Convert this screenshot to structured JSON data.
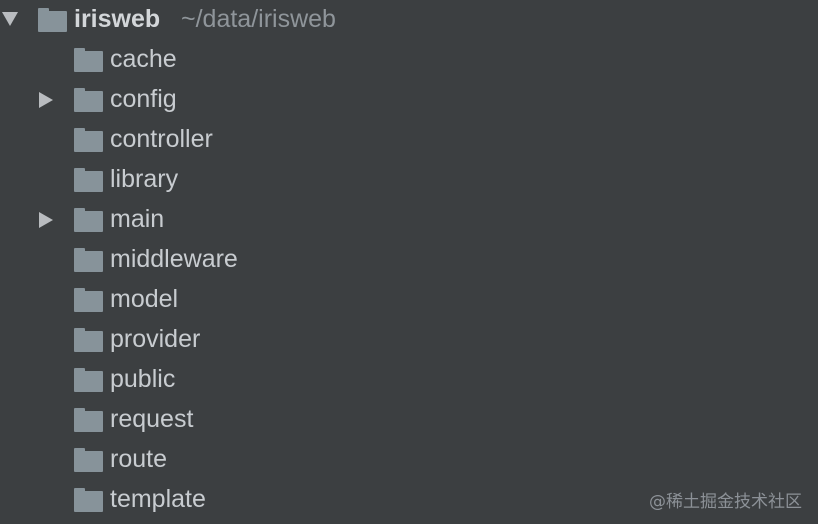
{
  "project": {
    "name": "irisweb",
    "path": "~/data/irisweb",
    "expanded": true,
    "icon": "folder-icon"
  },
  "items": [
    {
      "label": "cache",
      "expandable": false,
      "icon": "folder-icon"
    },
    {
      "label": "config",
      "expandable": true,
      "icon": "folder-icon"
    },
    {
      "label": "controller",
      "expandable": false,
      "icon": "folder-icon"
    },
    {
      "label": "library",
      "expandable": false,
      "icon": "folder-icon"
    },
    {
      "label": "main",
      "expandable": true,
      "icon": "folder-icon"
    },
    {
      "label": "middleware",
      "expandable": false,
      "icon": "folder-icon"
    },
    {
      "label": "model",
      "expandable": false,
      "icon": "folder-icon"
    },
    {
      "label": "provider",
      "expandable": false,
      "icon": "folder-icon"
    },
    {
      "label": "public",
      "expandable": false,
      "icon": "folder-icon"
    },
    {
      "label": "request",
      "expandable": false,
      "icon": "folder-icon"
    },
    {
      "label": "route",
      "expandable": false,
      "icon": "folder-icon"
    },
    {
      "label": "template",
      "expandable": false,
      "icon": "folder-icon"
    }
  ],
  "watermark": "@稀土掘金技术社区",
  "colors": {
    "background": "#3c3f41",
    "folder": "#87939a",
    "text": "#c8ccd0",
    "path": "#8f959a",
    "arrow": "#b9bcbf"
  }
}
